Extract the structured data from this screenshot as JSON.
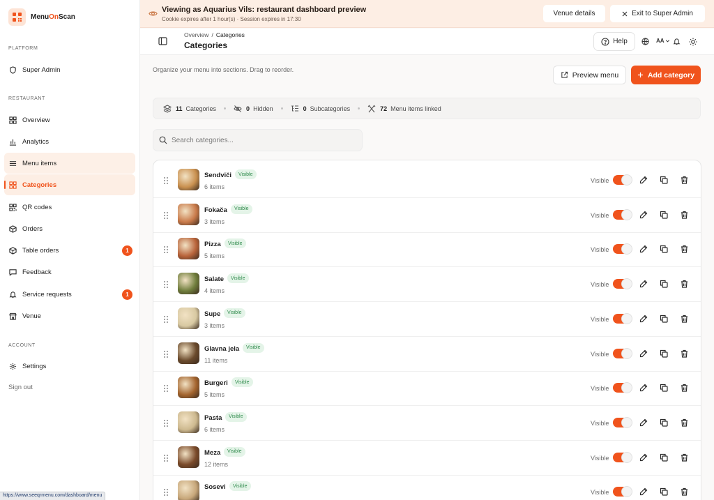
{
  "brand": {
    "name_prefix": "Menu",
    "name_accent": "On",
    "name_suffix": "Scan",
    "accent_color": "#f0531c"
  },
  "sidebar": {
    "sections": {
      "platform": "PLATFORM",
      "restaurant": "RESTAURANT",
      "account": "ACCOUNT"
    },
    "items": [
      {
        "label": "Super Admin",
        "icon": "shield-icon"
      },
      {
        "label": "Overview",
        "icon": "grid-icon"
      },
      {
        "label": "Analytics",
        "icon": "bar-chart-icon"
      },
      {
        "label": "Menu items",
        "icon": "list-icon"
      },
      {
        "label": "Categories",
        "icon": "grid-icon"
      },
      {
        "label": "QR codes",
        "icon": "qr-icon"
      },
      {
        "label": "Orders",
        "icon": "box-icon"
      },
      {
        "label": "Table orders",
        "icon": "box-icon",
        "badge": "1"
      },
      {
        "label": "Feedback",
        "icon": "message-icon"
      },
      {
        "label": "Service requests",
        "icon": "bell-icon",
        "badge": "1"
      },
      {
        "label": "Venue",
        "icon": "store-icon"
      },
      {
        "label": "Settings",
        "icon": "gear-icon"
      }
    ],
    "sign_out": "Sign out"
  },
  "status_url": "https://www.seeqrmenu.com/dashboard/menu",
  "banner": {
    "title": "Viewing as Aquarius Vils: restaurant dashboard preview",
    "subtitle": "Cookie expires after 1 hour(s) · Session expires in 17:30",
    "venue_details": "Venue details",
    "exit": "Exit to Super Admin"
  },
  "header": {
    "breadcrumb_parent": "Overview",
    "breadcrumb_sep": "/",
    "breadcrumb_current": "Categories",
    "title": "Categories",
    "help": "Help",
    "font_size": "AA"
  },
  "main": {
    "description": "Organize your menu into sections. Drag to reorder.",
    "preview_menu": "Preview menu",
    "add_category": "Add category",
    "stats": [
      {
        "value": "11",
        "label": "Categories"
      },
      {
        "value": "0",
        "label": "Hidden"
      },
      {
        "value": "0",
        "label": "Subcategories"
      },
      {
        "value": "72",
        "label": "Menu items linked"
      }
    ],
    "search_placeholder": "Search categories...",
    "visible_label": "Visible",
    "categories": [
      {
        "name": "Sendviči",
        "status": "Visible",
        "items": "6 items",
        "color": "#c9904f"
      },
      {
        "name": "Fokača",
        "status": "Visible",
        "items": "3 items",
        "color": "#c97a4a"
      },
      {
        "name": "Pizza",
        "status": "Visible",
        "items": "5 items",
        "color": "#b8633a"
      },
      {
        "name": "Salate",
        "status": "Visible",
        "items": "4 items",
        "color": "#6f7d3c"
      },
      {
        "name": "Supe",
        "status": "Visible",
        "items": "3 items",
        "color": "#d8c9a2"
      },
      {
        "name": "Glavna jela",
        "status": "Visible",
        "items": "11 items",
        "color": "#6a4a2c"
      },
      {
        "name": "Burgeri",
        "status": "Visible",
        "items": "5 items",
        "color": "#a3642e"
      },
      {
        "name": "Pasta",
        "status": "Visible",
        "items": "6 items",
        "color": "#cdb98f"
      },
      {
        "name": "Meza",
        "status": "Visible",
        "items": "12 items",
        "color": "#7a4a2a"
      },
      {
        "name": "Sosevi",
        "status": "Visible",
        "items": "",
        "color": "#c7a77a"
      }
    ]
  }
}
